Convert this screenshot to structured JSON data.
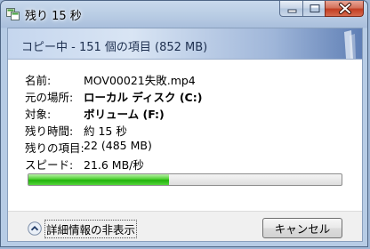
{
  "window": {
    "title": "残り 15 秒"
  },
  "banner": {
    "text": "コピー中 - 151 個の項目 (852 MB)"
  },
  "details": {
    "name_label": "名前:",
    "name_value": "MOV00021失敗.mp4",
    "from_label": "元の場所:",
    "from_value": "ローカル ディスク (C:)",
    "to_label": "対象:",
    "to_value": "ボリューム (F:)",
    "time_label": "残り時間:",
    "time_value": "約 15 秒",
    "items_label": "残りの項目:",
    "items_value": "22 (485 MB)",
    "speed_label": "スピード:",
    "speed_value": "21.6 MB/秒"
  },
  "progress": {
    "fraction": 0.45
  },
  "footer": {
    "toggle_label": "詳細情報の非表示",
    "cancel_label": "キャンセル"
  },
  "colors": {
    "progress_green": "#20b10b",
    "close_red": "#c23e22"
  },
  "icons": {
    "title": "file-copy-icon",
    "toggle": "chevron-up-icon"
  }
}
